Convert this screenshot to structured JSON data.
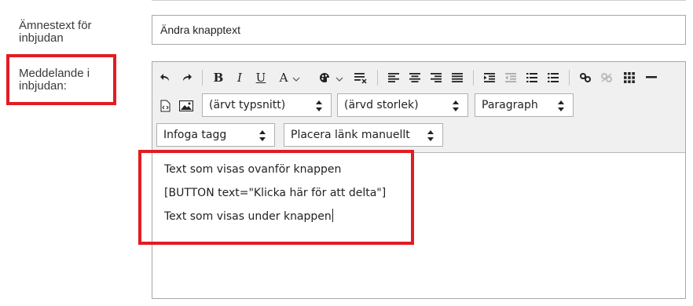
{
  "form": {
    "subject_label": "Ämnestext för inbjudan",
    "subject_value": "Ändra knapptext",
    "message_label": "Meddelande i inbjudan:"
  },
  "toolbar": {
    "font_select": "(ärvt typsnitt)",
    "size_select": "(ärvd storlek)",
    "block_select": "Paragraph",
    "insert_tag_select": "Infoga tagg",
    "link_select": "Placera länk manuellt",
    "bold_glyph": "B",
    "italic_glyph": "I",
    "underline_glyph": "U",
    "font_color_glyph": "A"
  },
  "editor": {
    "lines": [
      "Text som visas ovanför knappen",
      "[BUTTON text=\"Klicka här för att delta\"]",
      "Text som visas under knappen"
    ]
  },
  "colors": {
    "highlight": "#e21c22",
    "toolbar_bg": "#f0f0f0"
  }
}
